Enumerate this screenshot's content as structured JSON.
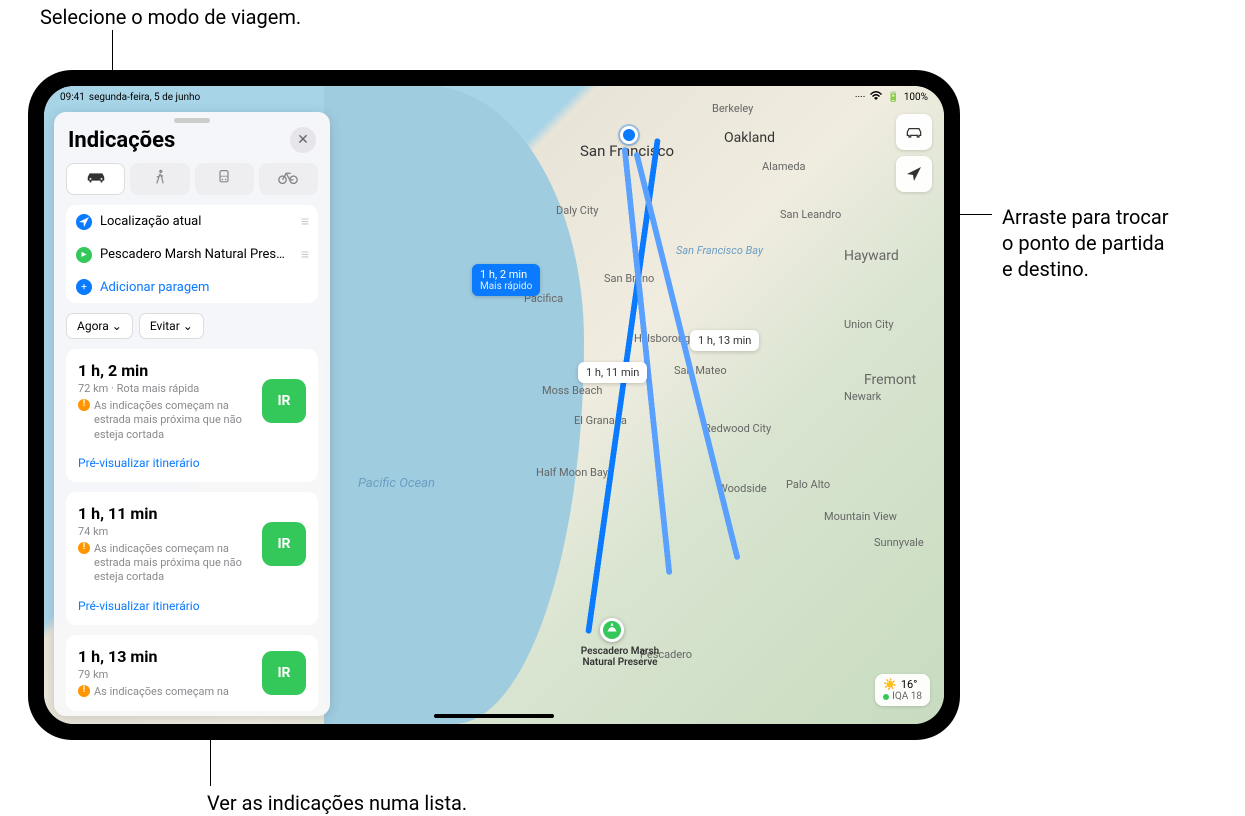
{
  "annotations": {
    "top": "Selecione o modo de viagem.",
    "right1": "Arraste para trocar",
    "right2": "o ponto de partida",
    "right3": "e destino.",
    "bottom": "Ver as indicações numa lista."
  },
  "status": {
    "time": "09:41",
    "date": "segunda-feira, 5 de junho",
    "dots": "····",
    "wifi": "wifi-icon",
    "battery": "100%"
  },
  "sidebar": {
    "title": "Indicações",
    "modes": [
      "car",
      "walk",
      "transit",
      "bike"
    ],
    "stops": {
      "current": "Localização atual",
      "destination": "Pescadero Marsh Natural Pres…",
      "add": "Adicionar paragem"
    },
    "options": {
      "now": "Agora",
      "avoid": "Evitar"
    },
    "routes": [
      {
        "time": "1 h, 2 min",
        "sub": "72 km · Rota mais rápida",
        "warning": "As indicações começam na estrada mais próxima que não esteja cortada",
        "go": "IR",
        "preview": "Pré-visualizar itinerário"
      },
      {
        "time": "1 h, 11 min",
        "sub": "74 km",
        "warning": "As indicações começam na estrada mais próxima que não esteja cortada",
        "go": "IR",
        "preview": "Pré-visualizar itinerário"
      },
      {
        "time": "1 h, 13 min",
        "sub": "79 km",
        "warning": "As indicações começam na",
        "go": "IR",
        "preview": ""
      }
    ]
  },
  "map": {
    "cities": {
      "sf": "San Francisco",
      "oakland": "Oakland",
      "berkeley": "Berkeley",
      "dalycity": "Daly City",
      "sanmateo": "San Mateo",
      "hayward": "Hayward",
      "fremont": "Fremont",
      "paloalto": "Palo Alto",
      "mtnview": "Mountain View",
      "redwood": "Redwood City",
      "halfmoon": "Half Moon Bay",
      "pacifica": "Pacifica",
      "sanbruno": "San Bruno",
      "mossbeach": "Moss Beach",
      "elgranada": "El Granada",
      "pescadero": "Pescadero",
      "alameda": "Alameda",
      "sanleandro": "San Leandro",
      "unioncity": "Union City",
      "newark": "Newark",
      "sunnyvale": "Sunnyvale",
      "woodside": "Woodside",
      "hillsborough": "Hillsborough",
      "sfbay": "San Francisco Bay",
      "ocean": "Pacific Ocean"
    },
    "route_pills": {
      "primary_time": "1 h, 2 min",
      "primary_sub": "Mais rápido",
      "alt1": "1 h, 11 min",
      "alt2": "1 h, 13 min"
    },
    "destination_name": "Pescadero Marsh\nNatural Preserve",
    "weather": {
      "temp": "16°",
      "aqi": "IQA 18"
    }
  }
}
